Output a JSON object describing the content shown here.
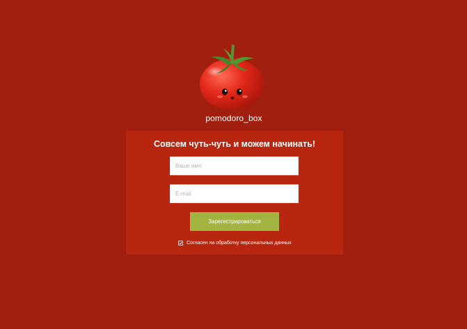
{
  "brand": {
    "logo_icon": "tomato-mascot-icon",
    "name": "pomodoro_box"
  },
  "form": {
    "title": "Совсем чуть-чуть и можем начинать!",
    "name_field": {
      "placeholder": "Ваше имя",
      "value": ""
    },
    "email_field": {
      "placeholder": "E-mail",
      "value": ""
    },
    "submit_label": "Зарегестрироваться",
    "consent": {
      "label": "Согласен на обработку персональных данных",
      "checked": true
    }
  },
  "colors": {
    "background": "#a01f0e",
    "card": "#b8260f",
    "button": "#a2b33f",
    "text": "#ffffff"
  }
}
